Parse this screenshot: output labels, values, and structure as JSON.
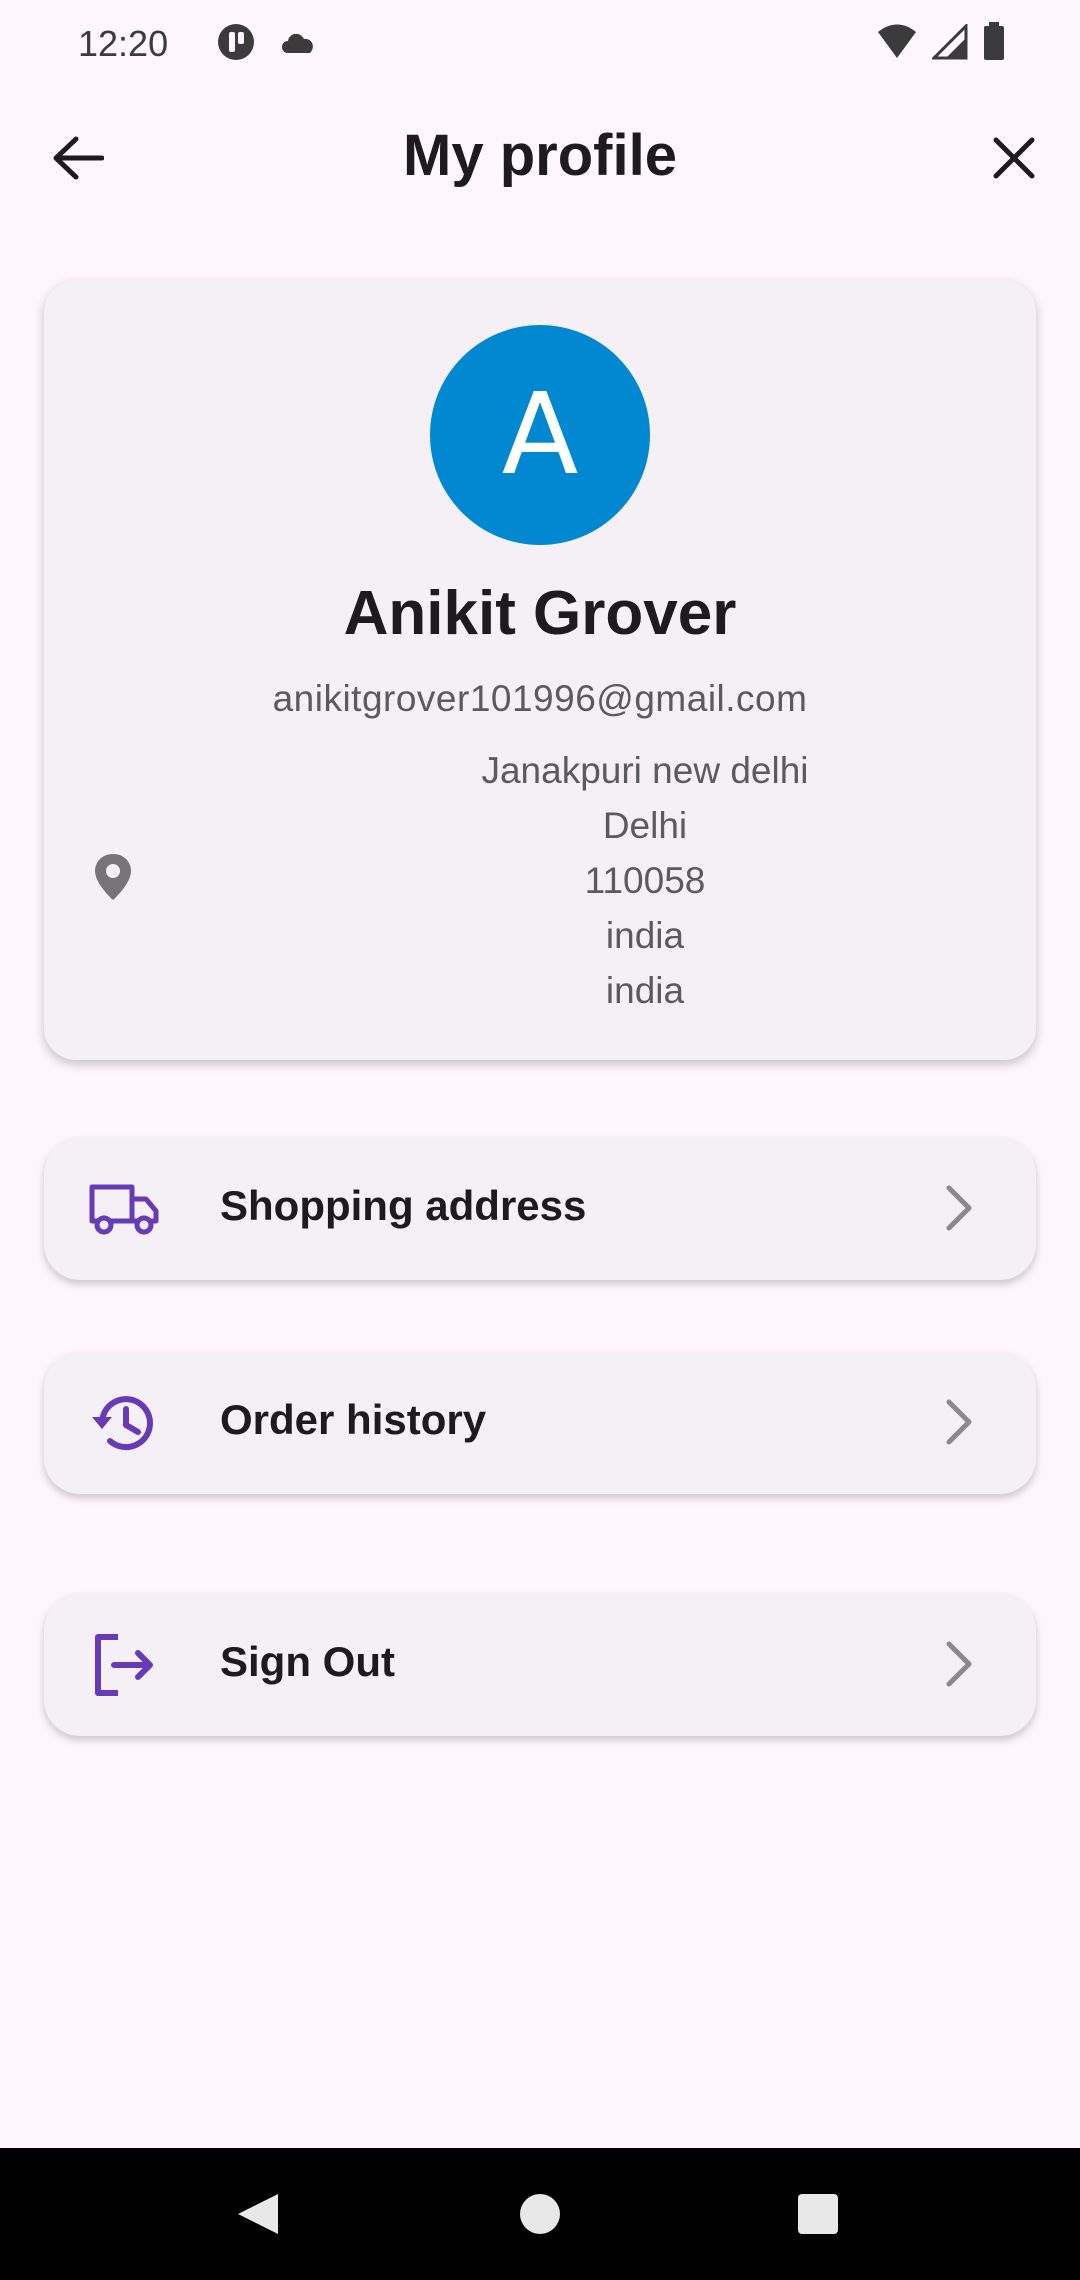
{
  "status_bar": {
    "time": "12:20"
  },
  "app_bar": {
    "title": "My profile"
  },
  "profile": {
    "avatar_initial": "A",
    "avatar_color": "#0288d1",
    "name": "Anikit Grover",
    "email": "anikitgrover101996@gmail.com",
    "address_lines": [
      "Janakpuri new delhi",
      "Delhi",
      "110058",
      "india",
      "india"
    ]
  },
  "menu": {
    "items": [
      {
        "label": "Shopping address",
        "icon": "truck-icon"
      },
      {
        "label": "Order history",
        "icon": "history-icon"
      },
      {
        "label": "Sign Out",
        "icon": "sign-out-icon"
      }
    ]
  },
  "colors": {
    "accent": "#673ab7",
    "background": "#fdf7fd",
    "card": "#f4f0f5"
  }
}
